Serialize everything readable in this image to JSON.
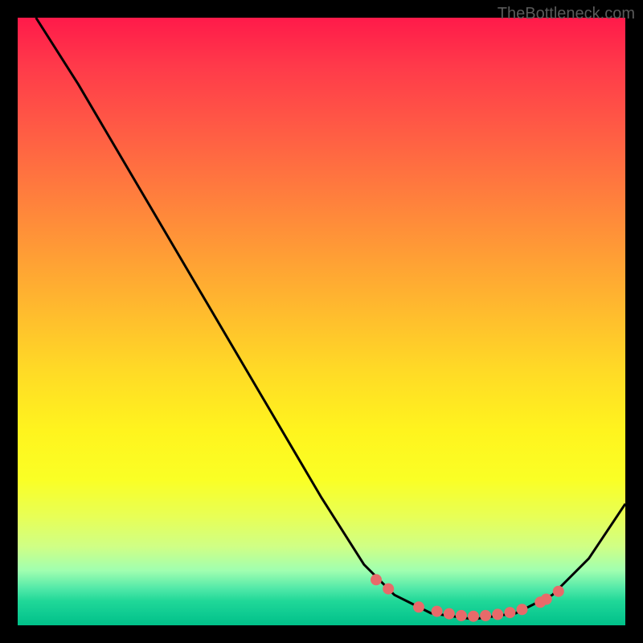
{
  "attribution": "TheBottleneck.com",
  "chart_data": {
    "type": "line",
    "title": "",
    "xlabel": "",
    "ylabel": "",
    "xlim": [
      0,
      100
    ],
    "ylim": [
      0,
      100
    ],
    "curve": [
      {
        "x": 3,
        "y": 100
      },
      {
        "x": 10,
        "y": 89
      },
      {
        "x": 20,
        "y": 72
      },
      {
        "x": 30,
        "y": 55
      },
      {
        "x": 40,
        "y": 38
      },
      {
        "x": 50,
        "y": 21
      },
      {
        "x": 57,
        "y": 10
      },
      {
        "x": 62,
        "y": 5
      },
      {
        "x": 68,
        "y": 2
      },
      {
        "x": 75,
        "y": 1
      },
      {
        "x": 82,
        "y": 2
      },
      {
        "x": 88,
        "y": 5
      },
      {
        "x": 94,
        "y": 11
      },
      {
        "x": 100,
        "y": 20
      }
    ],
    "markers": [
      {
        "x": 59,
        "y": 7.5
      },
      {
        "x": 61,
        "y": 6
      },
      {
        "x": 66,
        "y": 3
      },
      {
        "x": 69,
        "y": 2.3
      },
      {
        "x": 71,
        "y": 1.9
      },
      {
        "x": 73,
        "y": 1.6
      },
      {
        "x": 75,
        "y": 1.5
      },
      {
        "x": 77,
        "y": 1.6
      },
      {
        "x": 79,
        "y": 1.8
      },
      {
        "x": 81,
        "y": 2.1
      },
      {
        "x": 83,
        "y": 2.6
      },
      {
        "x": 86,
        "y": 3.8
      },
      {
        "x": 87,
        "y": 4.3
      },
      {
        "x": 89,
        "y": 5.6
      }
    ],
    "marker_color": "#e86a6a",
    "curve_color": "#000000"
  }
}
